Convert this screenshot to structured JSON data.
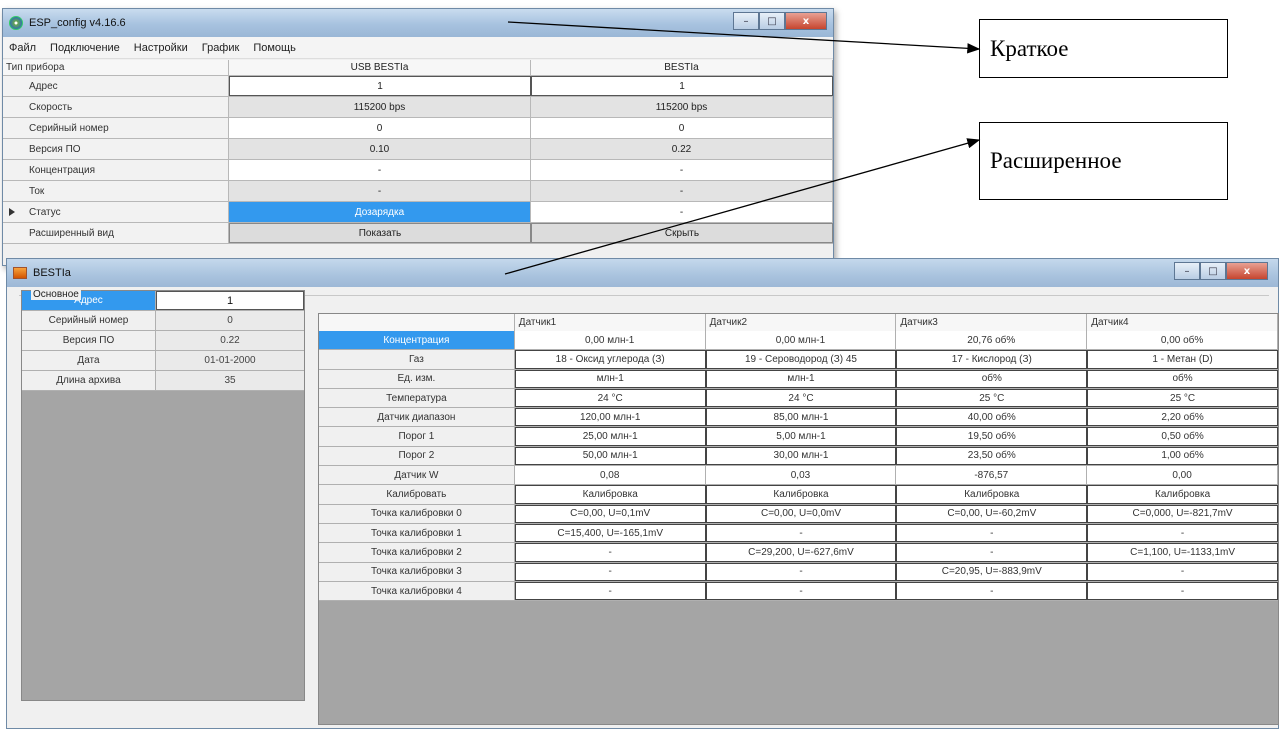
{
  "window1": {
    "title": "ESP_config v4.16.6",
    "menu": [
      "Файл",
      "Подключение",
      "Настройки",
      "График",
      "Помощь"
    ],
    "header": {
      "label": "Тип прибора",
      "col1": "USB BESTIa",
      "col2": "BESTIa"
    },
    "rows": [
      {
        "label": "Адрес",
        "col1": "1",
        "col2": "1"
      },
      {
        "label": "Скорость",
        "col1": "115200 bps",
        "col2": "115200 bps"
      },
      {
        "label": "Серийный номер",
        "col1": "0",
        "col2": "0"
      },
      {
        "label": "Версия ПО",
        "col1": "0.10",
        "col2": "0.22"
      },
      {
        "label": "Концентрация",
        "col1": "-",
        "col2": "-"
      },
      {
        "label": "Ток",
        "col1": "-",
        "col2": "-"
      },
      {
        "label": "Статус",
        "col1": "Дозарядка",
        "col2": "-"
      },
      {
        "label": "Расширенный вид",
        "col1": "Показать",
        "col2": "Скрыть"
      }
    ]
  },
  "window2": {
    "title": "BESTIa",
    "group_label": "Основное",
    "main": [
      {
        "label": "Адрес",
        "value": "1"
      },
      {
        "label": "Серийный номер",
        "value": "0"
      },
      {
        "label": "Версия ПО",
        "value": "0.22"
      },
      {
        "label": "Дата",
        "value": "01-01-2000"
      },
      {
        "label": "Длина архива",
        "value": "35"
      }
    ],
    "sensor_headers": [
      "Датчик1",
      "Датчик2",
      "Датчик3",
      "Датчик4"
    ],
    "sensor_rows": [
      {
        "label": "Концентрация",
        "values": [
          "0,00 млн-1",
          "0,00 млн-1",
          "20,76 об%",
          "0,00 об%"
        ]
      },
      {
        "label": "Газ",
        "values": [
          "18 - Оксид углерода (З)",
          "19 - Сероводород (З) 45",
          "17 - Кислород (З)",
          "1 - Метан (D)"
        ]
      },
      {
        "label": "Ед. изм.",
        "values": [
          "млн-1",
          "млн-1",
          "об%",
          "об%"
        ]
      },
      {
        "label": "Температура",
        "values": [
          "24 °C",
          "24 °C",
          "25 °C",
          "25 °C"
        ]
      },
      {
        "label": "Датчик диапазон",
        "values": [
          "120,00 млн-1",
          "85,00 млн-1",
          "40,00 об%",
          "2,20 об%"
        ]
      },
      {
        "label": "Порог 1",
        "values": [
          "25,00 млн-1",
          "5,00 млн-1",
          "19,50 об%",
          "0,50 об%"
        ]
      },
      {
        "label": "Порог 2",
        "values": [
          "50,00 млн-1",
          "30,00 млн-1",
          "23,50 об%",
          "1,00 об%"
        ]
      },
      {
        "label": "Датчик W",
        "values": [
          "0,08",
          "0,03",
          "-876,57",
          "0,00"
        ]
      },
      {
        "label": "Калибровать",
        "values": [
          "Калибровка",
          "Калибровка",
          "Калибровка",
          "Калибровка"
        ]
      },
      {
        "label": "Точка калибровки 0",
        "values": [
          "C=0,00, U=0,1mV",
          "C=0,00, U=0,0mV",
          "C=0,00, U=-60,2mV",
          "C=0,000, U=-821,7mV"
        ]
      },
      {
        "label": "Точка калибровки 1",
        "values": [
          "C=15,400, U=-165,1mV",
          "-",
          "-",
          "-"
        ]
      },
      {
        "label": "Точка калибровки 2",
        "values": [
          "-",
          "C=29,200, U=-627,6mV",
          "-",
          "C=1,100, U=-1133,1mV"
        ]
      },
      {
        "label": "Точка калибровки 3",
        "values": [
          "-",
          "-",
          "C=20,95, U=-883,9mV",
          "-"
        ]
      },
      {
        "label": "Точка калибровки 4",
        "values": [
          "-",
          "-",
          "-",
          "-"
        ]
      }
    ]
  },
  "annotations": {
    "short": "Краткое",
    "extended": "Расширенное"
  },
  "window_buttons": {
    "minimize": "–",
    "maximize": "□",
    "close": "x"
  }
}
